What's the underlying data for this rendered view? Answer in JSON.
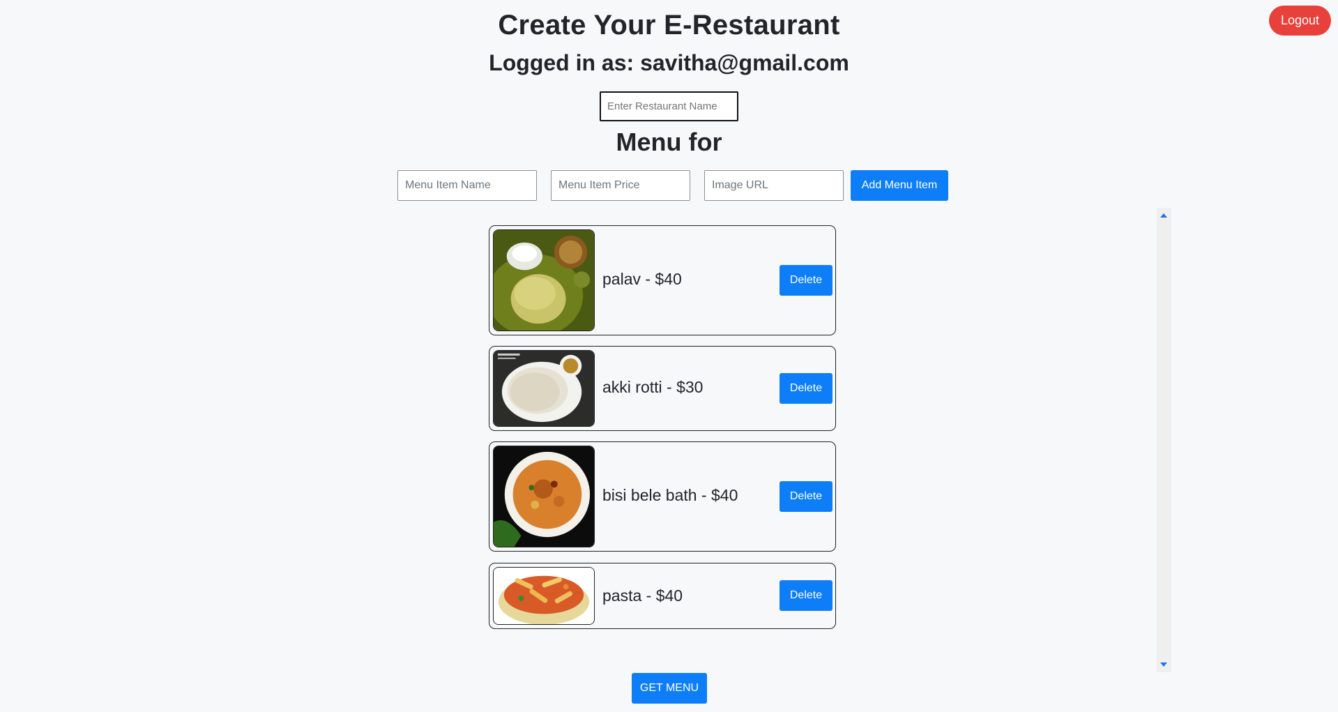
{
  "header": {
    "logout_label": "Logout",
    "title": "Create Your E-Restaurant",
    "logged_in_text": "Logged in as: savitha@gmail.com"
  },
  "restaurant": {
    "name_placeholder": "Enter Restaurant Name",
    "name_value": ""
  },
  "menu": {
    "heading": "Menu for",
    "item_name_placeholder": "Menu Item Name",
    "item_price_placeholder": "Menu Item Price",
    "image_url_placeholder": "Image URL",
    "add_label": "Add Menu Item",
    "items": [
      {
        "label": "palav - $40",
        "delete_label": "Delete",
        "image": "palav-food-image"
      },
      {
        "label": "akki rotti - $30",
        "delete_label": "Delete",
        "image": "akki-rotti-food-image"
      },
      {
        "label": "bisi bele bath - $40",
        "delete_label": "Delete",
        "image": "bisi-bele-bath-food-image"
      },
      {
        "label": "pasta - $40",
        "delete_label": "Delete",
        "image": "pasta-food-image"
      }
    ],
    "get_menu_label": "GET MENU"
  },
  "colors": {
    "primary": "#0d7ef8",
    "logout": "#e8403a",
    "background": "#f7f8fa"
  }
}
